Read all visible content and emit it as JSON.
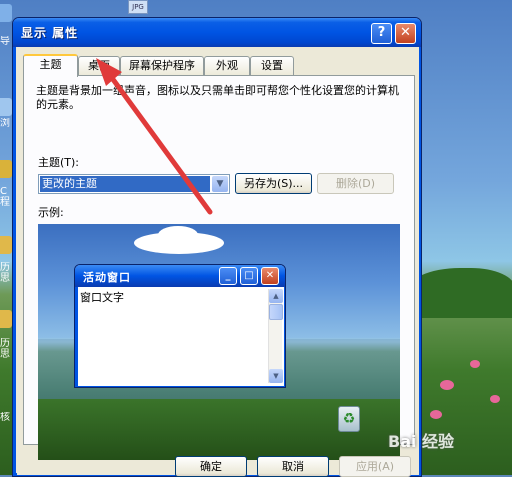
{
  "window": {
    "title": "显示 属性",
    "help_label": "?",
    "close_label": "✕"
  },
  "tabs": [
    {
      "label": "主题",
      "active": true
    },
    {
      "label": "桌面",
      "active": false
    },
    {
      "label": "屏幕保护程序",
      "active": false
    },
    {
      "label": "外观",
      "active": false
    },
    {
      "label": "设置",
      "active": false
    }
  ],
  "theme_page": {
    "description": "主题是背景加一组声音，图标以及只需单击即可帮您个性化设置您的计算机的元素。",
    "theme_label": "主题(T):",
    "theme_value": "更改的主题",
    "save_as_label": "另存为(S)...",
    "delete_label": "删除(D)",
    "preview_label": "示例:"
  },
  "preview_window": {
    "title": "活动窗口",
    "content_text": "窗口文字"
  },
  "footer": {
    "ok_label": "确定",
    "cancel_label": "取消",
    "apply_label": "应用(A)"
  },
  "desktop_icons": [
    {
      "label": "导"
    },
    {
      "label": "浏"
    },
    {
      "label": "C程"
    },
    {
      "label": "历思"
    },
    {
      "label": "历思"
    },
    {
      "label": "核"
    }
  ],
  "watermark": "Bai 经验",
  "colors": {
    "title_blue": "#0054e3",
    "close_red": "#c2411f",
    "arrow": "#e03a3a",
    "selection": "#316ac5"
  }
}
